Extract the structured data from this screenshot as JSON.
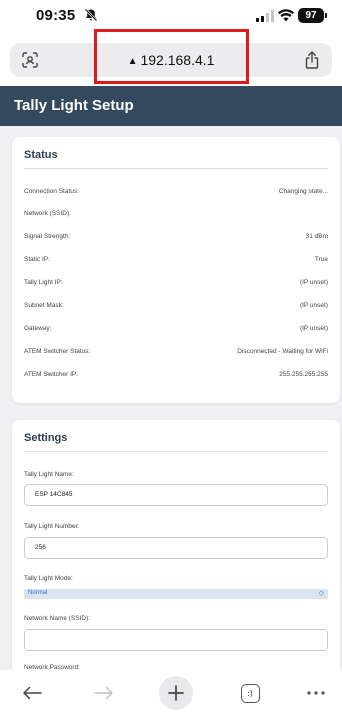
{
  "status_bar": {
    "time": "09:35",
    "battery": "97"
  },
  "browser": {
    "url": "192.168.4.1",
    "url_prefix_icon": "▲",
    "highlight_color": "#e01818"
  },
  "page": {
    "title": "Tally Light Setup",
    "header_color": "#34495e"
  },
  "status": {
    "title": "Status",
    "rows": [
      {
        "label": "Connection Status:",
        "value": "Changing state..."
      },
      {
        "label": "Network (SSID):",
        "value": ""
      },
      {
        "label": "Signal Strength:",
        "value": "31 dBm"
      },
      {
        "label": "Static IP:",
        "value": "True"
      },
      {
        "label": "Tally Light IP:",
        "value": "(IP unset)"
      },
      {
        "label": "Subnet Mask:",
        "value": "(IP unset)"
      },
      {
        "label": "Gateway:",
        "value": "(IP unset)"
      },
      {
        "label": "ATEM Switcher Status:",
        "value": "Disconnected - Waiting for WiFi"
      },
      {
        "label": "ATEM Switcher IP:",
        "value": "255.255.255.255"
      }
    ]
  },
  "settings": {
    "title": "Settings",
    "tally_name_label": "Tally Light Name:",
    "tally_name_value": "ESP 14C845",
    "tally_number_label": "Tally Light Number:",
    "tally_number_value": "256",
    "tally_mode_label": "Tally Light Mode:",
    "tally_mode_value": "Normal",
    "ssid_label": "Network Name (SSID):",
    "ssid_value": "",
    "password_label": "Network Password:"
  },
  "toolbar": {
    "tabs_glyph": ":)"
  }
}
